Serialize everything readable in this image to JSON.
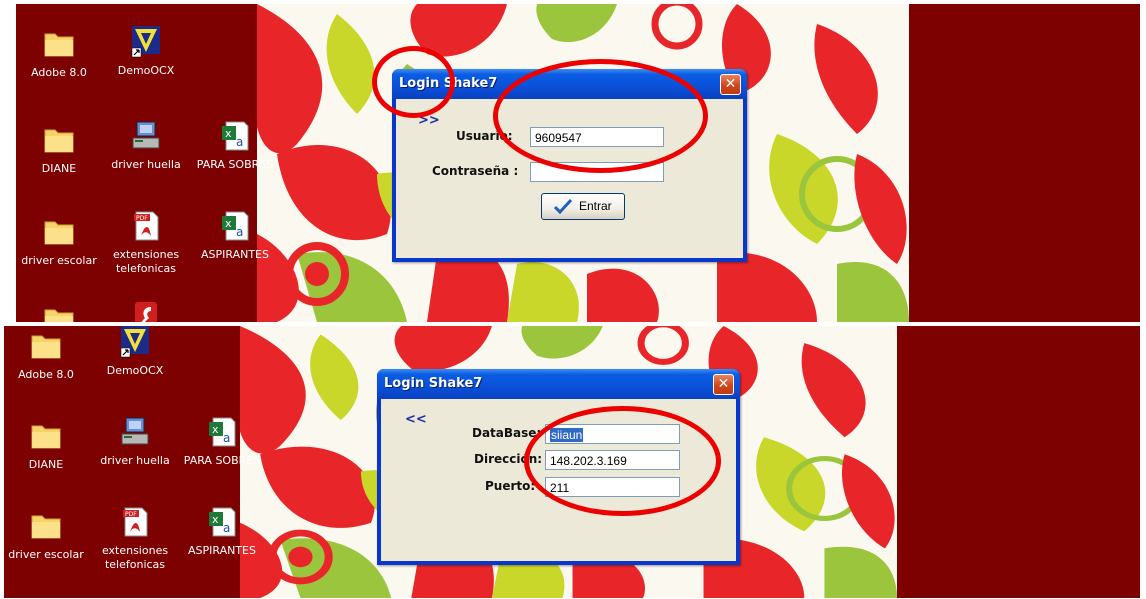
{
  "colors": {
    "desktop": "#7d0100",
    "annotation_circle": "#ec0000",
    "dialog_body": "#ece9d8",
    "title_blue": "#0b50d8"
  },
  "desktop_icons": {
    "adobe": "Adobe 8.0",
    "demoocx": "DemoOCX",
    "diane": "DIANE",
    "driver_huella": "driver huella",
    "para_sobres": "PARA SOBRES",
    "driver_escolar": "driver escolar",
    "extensiones": "extensiones telefonicas",
    "aspirantes": "ASPIRANTES"
  },
  "icon_names": [
    "folder-icon",
    "demoocx-icon",
    "driver-icon",
    "excel-icon",
    "pdf-icon",
    "flash-icon",
    "shortcut-arrow-icon"
  ],
  "login_dialog": {
    "title": "Login Shake7",
    "close_glyph": "✕",
    "expand_link": ">>",
    "usuario_label": "Usuario:",
    "usuario_value": "9609547",
    "password_label": "Contraseña :",
    "password_value": "",
    "enter_button": "Entrar"
  },
  "config_dialog": {
    "title": "Login Shake7",
    "close_glyph": "✕",
    "collapse_link": "<<",
    "database_label": "DataBase:",
    "database_value": "siiaun",
    "direccion_label": "Dirección:",
    "direccion_value": "148.202.3.169",
    "puerto_label": "Puerto:",
    "puerto_value": "211"
  }
}
